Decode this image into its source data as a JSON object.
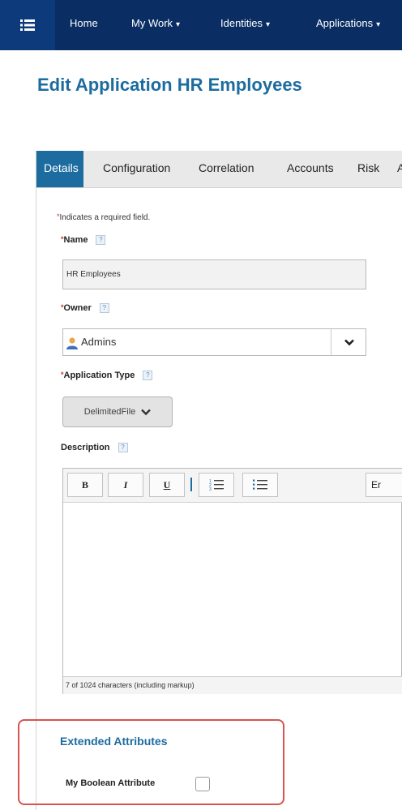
{
  "nav": {
    "items": [
      {
        "label": "Home",
        "has_caret": false
      },
      {
        "label": "My Work",
        "has_caret": true
      },
      {
        "label": "Identities",
        "has_caret": true
      },
      {
        "label": "Applications",
        "has_caret": true
      }
    ],
    "caret_char": "▾"
  },
  "page": {
    "title": "Edit Application HR Employees"
  },
  "tabs": [
    {
      "label": "Details",
      "active": true
    },
    {
      "label": "Configuration",
      "active": false
    },
    {
      "label": "Correlation",
      "active": false
    },
    {
      "label": "Accounts",
      "active": false
    },
    {
      "label": "Risk",
      "active": false
    },
    {
      "label": "A",
      "active": false
    }
  ],
  "form": {
    "required_note": "Indicates a required field.",
    "required_mark": "*",
    "help_mark": "?",
    "name": {
      "label": "Name",
      "value": "HR Employees"
    },
    "owner": {
      "label": "Owner",
      "value": "Admins"
    },
    "app_type": {
      "label": "Application Type",
      "value": "DelimitedFile"
    },
    "description": {
      "label": "Description",
      "toolbar": {
        "bold": "B",
        "italic": "I",
        "underline": "U",
        "right_label": "Er"
      },
      "char_count": "7 of 1024 characters (including markup)"
    }
  },
  "extended": {
    "title": "Extended Attributes",
    "bool_label": "My Boolean Attribute",
    "bool_checked": false
  },
  "colors": {
    "nav_bg": "#0a2e63",
    "accent": "#1c6ca0",
    "highlight": "#d9534f"
  }
}
